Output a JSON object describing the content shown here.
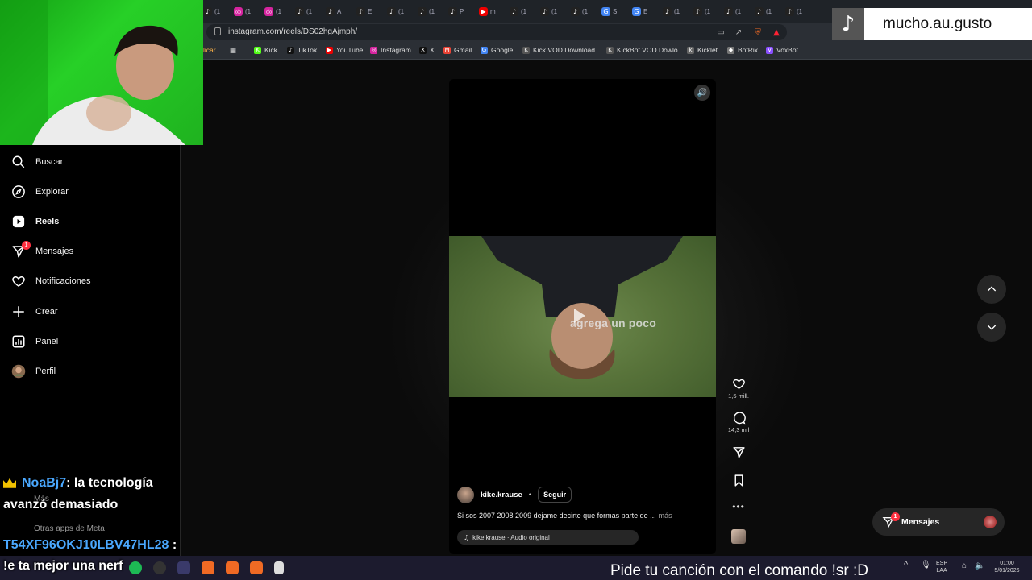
{
  "browser": {
    "url": "instagram.com/reels/DS02hgAjmph/",
    "tabs": [
      {
        "icon": "tiktok-icon",
        "color": "#222",
        "glyph": "♪",
        "t": "(1"
      },
      {
        "icon": "instagram-icon",
        "color": "#d6249f",
        "glyph": "◎",
        "t": "(1"
      },
      {
        "icon": "instagram-icon",
        "color": "#d6249f",
        "glyph": "◎",
        "t": "(1"
      },
      {
        "icon": "tiktok-icon",
        "color": "#222",
        "glyph": "♪",
        "t": "(1"
      },
      {
        "icon": "tiktok-icon",
        "color": "#222",
        "glyph": "♪",
        "t": "A"
      },
      {
        "icon": "tiktok-icon",
        "color": "#222",
        "glyph": "♪",
        "t": "E"
      },
      {
        "icon": "tiktok-icon",
        "color": "#222",
        "glyph": "♪",
        "t": "(1"
      },
      {
        "icon": "tiktok-icon",
        "color": "#222",
        "glyph": "♪",
        "t": "(1"
      },
      {
        "icon": "tiktok-icon",
        "color": "#222",
        "glyph": "♪",
        "t": "P"
      },
      {
        "icon": "youtube-icon",
        "color": "#e00",
        "glyph": "▶",
        "t": "m"
      },
      {
        "icon": "tiktok-icon",
        "color": "#222",
        "glyph": "♪",
        "t": "(1"
      },
      {
        "icon": "tiktok-icon",
        "color": "#222",
        "glyph": "♪",
        "t": "(1"
      },
      {
        "icon": "tiktok-icon",
        "color": "#222",
        "glyph": "♪",
        "t": "(1"
      },
      {
        "icon": "google-icon",
        "color": "#4285f4",
        "glyph": "G",
        "t": "S"
      },
      {
        "icon": "google-icon",
        "color": "#4285f4",
        "glyph": "G",
        "t": "E"
      },
      {
        "icon": "tiktok-icon",
        "color": "#222",
        "glyph": "♪",
        "t": "(1"
      },
      {
        "icon": "tiktok-icon",
        "color": "#222",
        "glyph": "♪",
        "t": "(1"
      },
      {
        "icon": "tiktok-icon",
        "color": "#222",
        "glyph": "♪",
        "t": "(1"
      },
      {
        "icon": "tiktok-icon",
        "color": "#222",
        "glyph": "♪",
        "t": "(1"
      },
      {
        "icon": "tiktok-icon",
        "color": "#222",
        "glyph": "♪",
        "t": "(1"
      }
    ],
    "bookmarks": [
      {
        "label": "Kick",
        "icon": "kick-icon",
        "color": "#53fc18",
        "glyph": "K"
      },
      {
        "label": "TikTok",
        "icon": "tiktok-icon",
        "color": "#111",
        "glyph": "♪"
      },
      {
        "label": "YouTube",
        "icon": "youtube-icon",
        "color": "#e00",
        "glyph": "▶"
      },
      {
        "label": "Instagram",
        "icon": "instagram-icon",
        "color": "#d6249f",
        "glyph": "◎"
      },
      {
        "label": "X",
        "icon": "x-icon",
        "color": "#111",
        "glyph": "X"
      },
      {
        "label": "Gmail",
        "icon": "gmail-icon",
        "color": "#ea4335",
        "glyph": "M"
      },
      {
        "label": "Google",
        "icon": "google-icon",
        "color": "#4285f4",
        "glyph": "G"
      },
      {
        "label": "Kick VOD Download...",
        "icon": "kick-vod-icon",
        "color": "#555",
        "glyph": "K"
      },
      {
        "label": "KickBot VOD Dowlo...",
        "icon": "kickbot-icon",
        "color": "#555",
        "glyph": "K"
      },
      {
        "label": "Kicklet",
        "icon": "kicklet-icon",
        "color": "#666",
        "glyph": "k"
      },
      {
        "label": "BotRix",
        "icon": "botrix-icon",
        "color": "#777",
        "glyph": "◆"
      },
      {
        "label": "VoxBot",
        "icon": "voxbot-icon",
        "color": "#8a4fff",
        "glyph": "V"
      }
    ],
    "bookmark_partial": "licar"
  },
  "sidebar": {
    "items": [
      {
        "label": "Buscar",
        "icon": "search-icon"
      },
      {
        "label": "Explorar",
        "icon": "compass-icon"
      },
      {
        "label": "Reels",
        "icon": "reels-icon",
        "active": true
      },
      {
        "label": "Mensajes",
        "icon": "messenger-icon",
        "badge": "1"
      },
      {
        "label": "Notificaciones",
        "icon": "heart-icon"
      },
      {
        "label": "Crear",
        "icon": "plus-icon"
      },
      {
        "label": "Panel",
        "icon": "dashboard-icon"
      },
      {
        "label": "Perfil",
        "icon": "avatar"
      }
    ],
    "more_label": "Más",
    "meta_apps_label": "Otras apps de Meta"
  },
  "reel": {
    "author": "kike.krause",
    "separator": "•",
    "follow_label": "Seguir",
    "description": "Si sos 2007 2008 2009 dejame decirte que formas parte de ...",
    "more_label": "más",
    "audio": "kike.krause · Audio original",
    "video_overlay_text": "agrega un poco",
    "sound_icon": "speaker-icon"
  },
  "actions": {
    "likes": "1,5 mill.",
    "comments": "14,3 mil"
  },
  "messages_pill": {
    "label": "Mensajes",
    "badge": "1"
  },
  "stream": {
    "tiktok_handle": "mucho.au.gusto",
    "chat": [
      {
        "user": "NoaBj7",
        "text": ": la tecnología"
      },
      {
        "user": "",
        "text": "avanzó demasiado"
      },
      {
        "user": "T54XF96OKJ10LBV47HL28",
        "text": " :"
      },
      {
        "user": "",
        "text": "!e ta mejor una nerf"
      }
    ],
    "song_request": "Pide tu canción con el comando !sr :D"
  },
  "taskbar": {
    "lang_top": "ESP",
    "lang_bottom": "LAA",
    "time": "01:00",
    "date": "5/01/2026"
  },
  "colors": {
    "accent_notification": "#ff3040",
    "chat_username": "#4aa8ff",
    "webcam_green": "#27d027"
  }
}
